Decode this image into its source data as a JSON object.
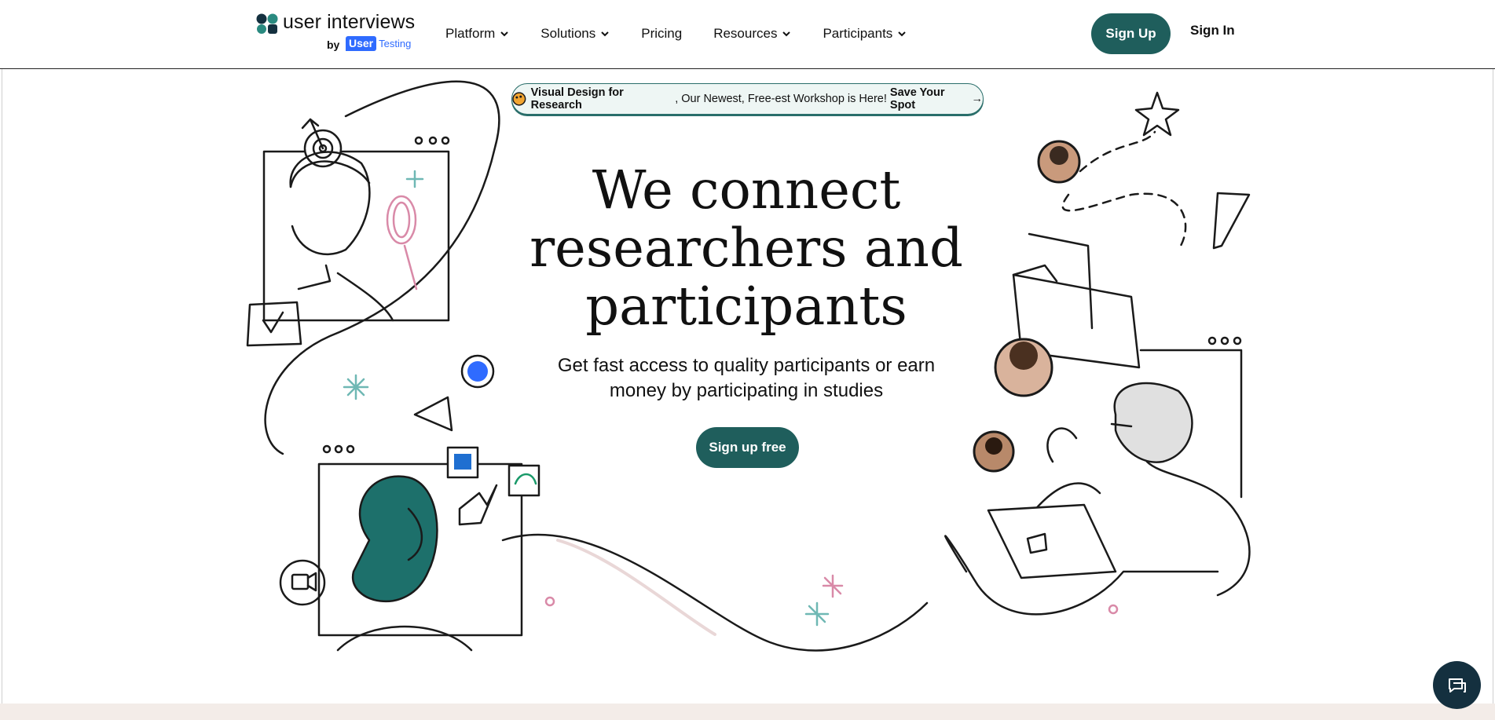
{
  "logo": {
    "brand": "user interviews",
    "by": "by",
    "ut_user": "User",
    "ut_testing": "Testing"
  },
  "nav": {
    "items": [
      {
        "label": "Platform",
        "has_dropdown": true
      },
      {
        "label": "Solutions",
        "has_dropdown": true
      },
      {
        "label": "Pricing",
        "has_dropdown": false
      },
      {
        "label": "Resources",
        "has_dropdown": true
      },
      {
        "label": "Participants",
        "has_dropdown": true
      }
    ],
    "signup_label": "Sign Up",
    "signin_label": "Sign In"
  },
  "banner": {
    "bold_lead": "Visual Design for Research",
    "middle": ", Our Newest, Free-est Workshop is Here! ",
    "cta": "Save Your Spot",
    "arrow": "→"
  },
  "hero": {
    "title_line1": "We connect",
    "title_line2": "researchers and",
    "title_line3": "participants",
    "subtitle_line1": "Get fast access to quality participants or earn",
    "subtitle_line2": "money by participating in studies",
    "cta_label": "Sign up free"
  },
  "colors": {
    "accent": "#1f5e5c",
    "usertesting_blue": "#2f6bff",
    "chat_bg": "#14303f",
    "teal_hair": "#1d706b",
    "pink": "#d98aa8"
  },
  "icons": {
    "chat": "chat-bubble-icon",
    "chevron": "chevron-down-icon",
    "banner": "palette-icon"
  }
}
